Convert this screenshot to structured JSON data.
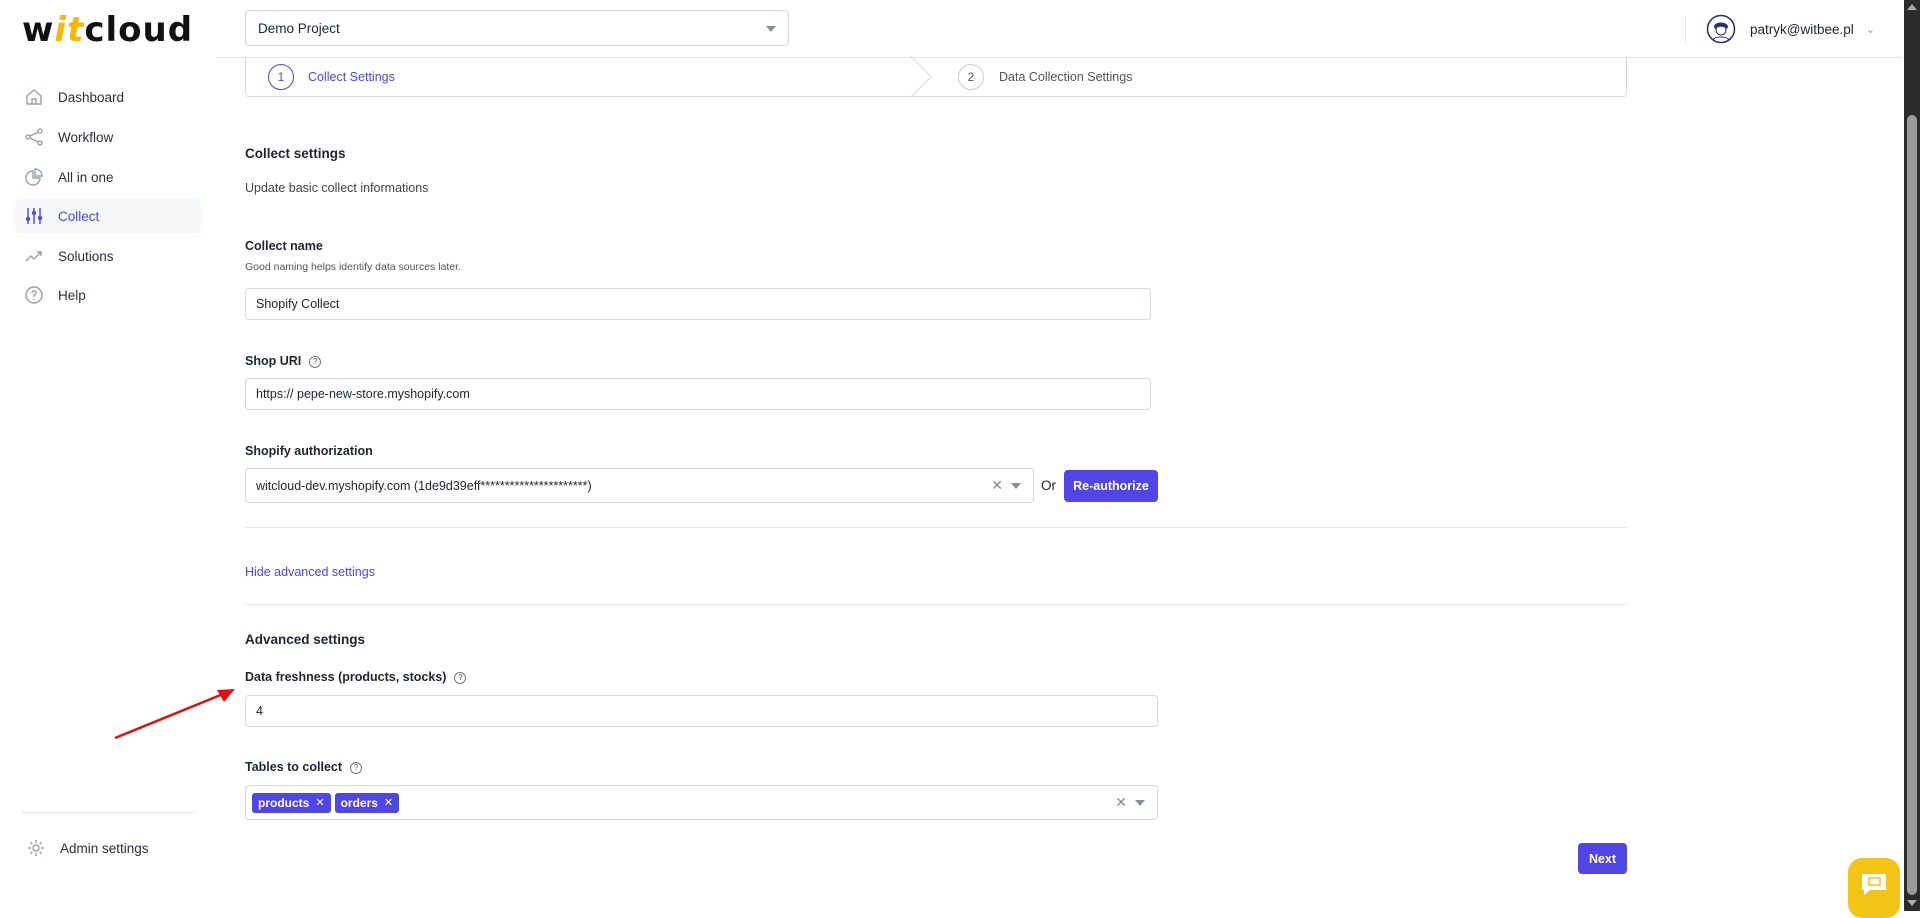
{
  "logo": {
    "pre": "w",
    "it": "it",
    "post": "cloud"
  },
  "sidebar": {
    "items": [
      {
        "label": "Dashboard",
        "icon": "home-icon"
      },
      {
        "label": "Workflow",
        "icon": "share-icon"
      },
      {
        "label": "All in one",
        "icon": "pie-chart-icon"
      },
      {
        "label": "Collect",
        "icon": "sliders-icon",
        "active": true
      },
      {
        "label": "Solutions",
        "icon": "trending-icon"
      },
      {
        "label": "Help",
        "icon": "help-icon"
      }
    ],
    "admin": "Admin settings"
  },
  "header": {
    "project": "Demo Project",
    "user": "patryk@witbee.pl"
  },
  "stepper": {
    "steps": [
      {
        "num": "1",
        "label": "Collect Settings"
      },
      {
        "num": "2",
        "label": "Data Collection Settings"
      }
    ]
  },
  "form": {
    "title": "Collect settings",
    "subtitle": "Update basic collect informations",
    "name_label": "Collect name",
    "name_hint": "Good naming helps identify data sources later.",
    "name_value": "Shopify Collect",
    "uri_label": "Shop URI",
    "uri_value": "https:// pepe-new-store.myshopify.com",
    "auth_label": "Shopify authorization",
    "auth_value": "witcloud-dev.myshopify.com (1de9d39eff**********************)",
    "or": "Or",
    "reauth": "Re-authorize",
    "toggle_advanced": "Hide advanced settings",
    "advanced_title": "Advanced settings",
    "freshness_label": "Data freshness (products, stocks)",
    "freshness_value": "4",
    "tables_label": "Tables to collect",
    "tables": [
      "products",
      "orders"
    ],
    "next": "Next"
  },
  "colors": {
    "accent": "#4f46e5",
    "chat": "#f2c418"
  }
}
